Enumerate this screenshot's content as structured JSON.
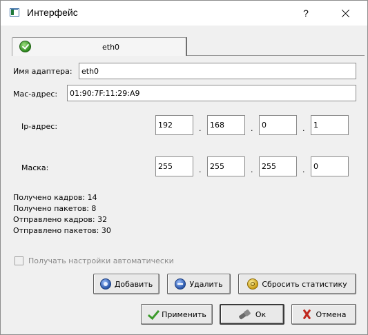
{
  "window": {
    "title": "Интерфейс",
    "help_label": "?",
    "icons": {
      "app": "network-window-icon",
      "close": "close-icon"
    }
  },
  "tab": {
    "label": "eth0",
    "icon": "check-ok-icon"
  },
  "adapter": {
    "label": "Имя адаптера:",
    "value": "eth0"
  },
  "mac": {
    "label": "Мас-адрес:",
    "value": "01:90:7F:11:29:A9"
  },
  "ip": {
    "label": "Ip-адрес:",
    "octets": [
      "192",
      "168",
      "0",
      "1"
    ]
  },
  "mask": {
    "label": "Маска:",
    "octets": [
      "255",
      "255",
      "255",
      "0"
    ]
  },
  "separator": ".",
  "stats": [
    "Получено кадров: 14",
    "Получено пакетов: 8",
    "Отправлено кадров: 32",
    "Отправлено пакетов: 30"
  ],
  "auto_config": {
    "label": "Получать настройки автоматически",
    "checked": false,
    "enabled": false
  },
  "buttons": {
    "add": "Добавить",
    "remove": "Удалить",
    "reset_stats": "Сбросить статистику",
    "apply": "Применить",
    "ok": "Ок",
    "cancel": "Отмена"
  },
  "colors": {
    "window_bg": "#f0f0f0",
    "titlebar_bg": "#ffffff",
    "disabled_text": "#8a8a8a"
  }
}
